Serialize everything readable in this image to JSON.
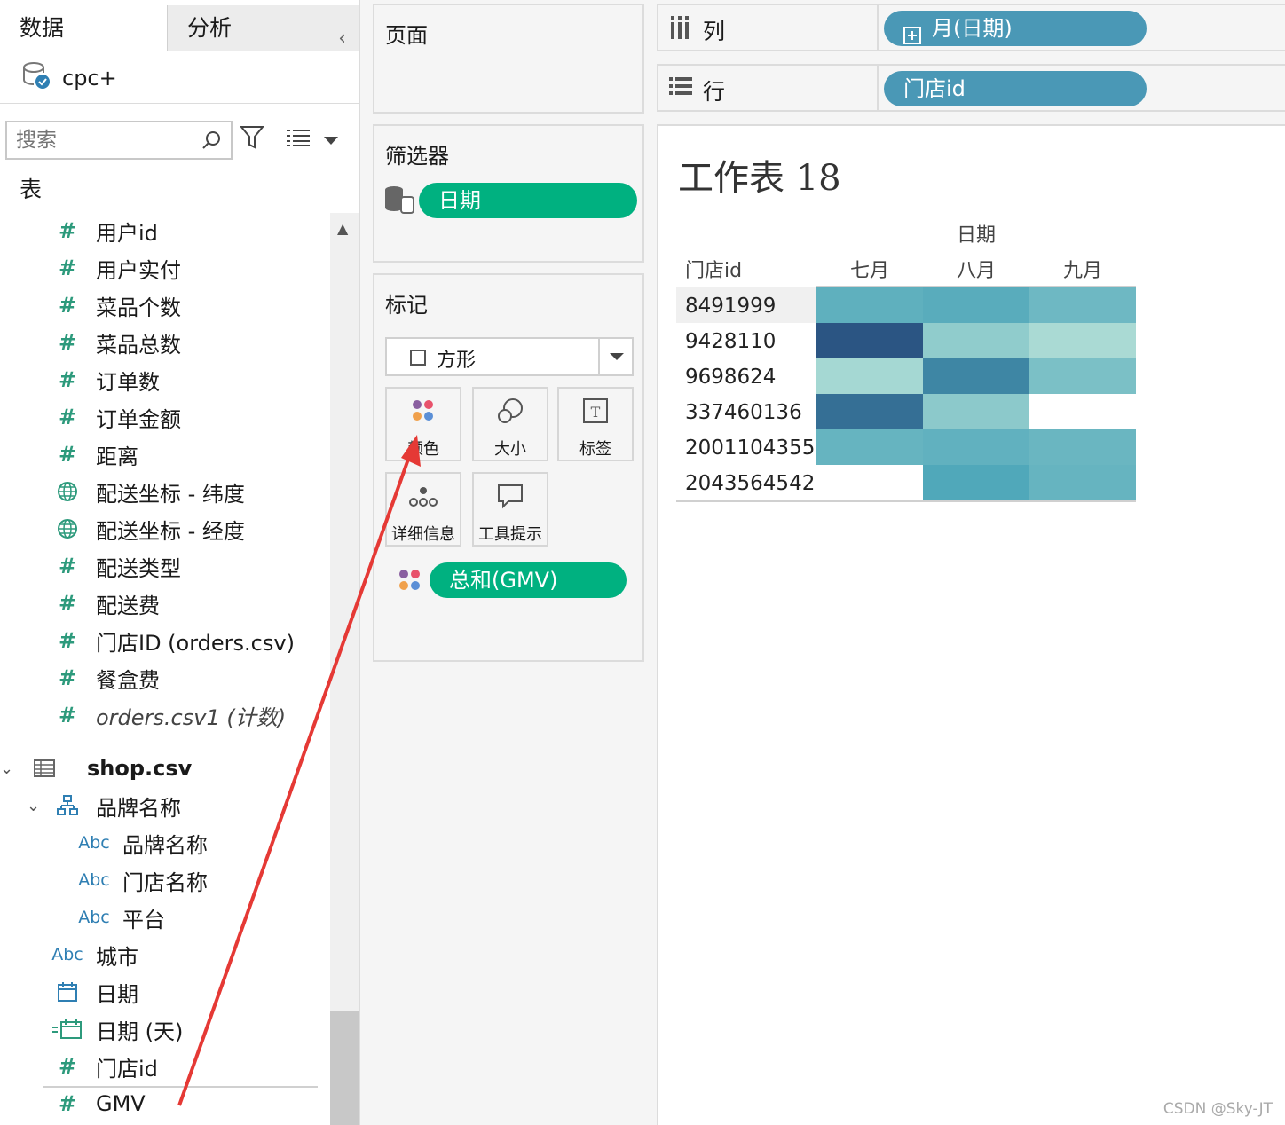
{
  "left_pane": {
    "tabs": {
      "data": "数据",
      "analysis": "分析"
    },
    "datasource": "cpc+",
    "search_placeholder": "搜索",
    "tables_title": "表",
    "orders_fields": [
      {
        "label": "用户id",
        "type": "measure"
      },
      {
        "label": "用户实付",
        "type": "measure"
      },
      {
        "label": "菜品个数",
        "type": "measure"
      },
      {
        "label": "菜品总数",
        "type": "measure"
      },
      {
        "label": "订单数",
        "type": "measure"
      },
      {
        "label": "订单金额",
        "type": "measure"
      },
      {
        "label": "距离",
        "type": "measure"
      },
      {
        "label": "配送坐标 - 纬度",
        "type": "geo"
      },
      {
        "label": "配送坐标 - 经度",
        "type": "geo"
      },
      {
        "label": "配送类型",
        "type": "measure"
      },
      {
        "label": "配送费",
        "type": "measure"
      },
      {
        "label": "门店ID (orders.csv)",
        "type": "measure"
      },
      {
        "label": "餐盒费",
        "type": "measure"
      },
      {
        "label": "orders.csv1 (计数)",
        "type": "measure-italic"
      }
    ],
    "shop_table": "shop.csv",
    "hierarchy": "品牌名称",
    "hierarchy_fields": [
      "品牌名称",
      "门店名称",
      "平台"
    ],
    "shop_fields": [
      {
        "label": "城市",
        "type": "string"
      },
      {
        "label": "日期",
        "type": "date"
      },
      {
        "label": "日期 (天)",
        "type": "date-custom"
      },
      {
        "label": "门店id",
        "type": "measure"
      },
      {
        "label": "GMV",
        "type": "measure"
      }
    ],
    "abc_label": "Abc"
  },
  "pages_shelf": {
    "title": "页面"
  },
  "filters_shelf": {
    "title": "筛选器",
    "pill": "日期"
  },
  "marks_card": {
    "title": "标记",
    "mark_type": "方形",
    "buttons": {
      "color": "颜色",
      "size": "大小",
      "label": "标签",
      "detail": "详细信息",
      "tooltip": "工具提示"
    },
    "color_pill": "总和(GMV)"
  },
  "columns_shelf": {
    "label": "列",
    "pill": "月(日期)"
  },
  "rows_shelf": {
    "label": "行",
    "pill": "门店id"
  },
  "view": {
    "sheet_title": "工作表 18",
    "watermark": "CSDN @Sky-JT"
  },
  "chart_data": {
    "type": "heatmap",
    "title": "工作表 18",
    "column_header": "日期",
    "row_header": "门店id",
    "x_categories": [
      "七月",
      "八月",
      "九月"
    ],
    "y_categories": [
      "8491999",
      "9428110",
      "9698624",
      "337460136",
      "2001104355",
      "2043564542"
    ],
    "measure": "总和(GMV)",
    "cells": [
      {
        "store": "8491999",
        "month": "七月",
        "level": 0.45
      },
      {
        "store": "8491999",
        "month": "八月",
        "level": 0.48
      },
      {
        "store": "8491999",
        "month": "九月",
        "level": 0.38
      },
      {
        "store": "9428110",
        "month": "七月",
        "level": 1.0
      },
      {
        "store": "9428110",
        "month": "八月",
        "level": 0.22
      },
      {
        "store": "9428110",
        "month": "九月",
        "level": 0.1
      },
      {
        "store": "9698624",
        "month": "七月",
        "level": 0.12
      },
      {
        "store": "9698624",
        "month": "八月",
        "level": 0.72
      },
      {
        "store": "9698624",
        "month": "九月",
        "level": 0.32
      },
      {
        "store": "337460136",
        "month": "七月",
        "level": 0.85
      },
      {
        "store": "337460136",
        "month": "八月",
        "level": 0.24
      },
      {
        "store": "2001104355",
        "month": "七月",
        "level": 0.42
      },
      {
        "store": "2001104355",
        "month": "八月",
        "level": 0.44
      },
      {
        "store": "2001104355",
        "month": "九月",
        "level": 0.4
      },
      {
        "store": "2043564542",
        "month": "八月",
        "level": 0.52
      },
      {
        "store": "2043564542",
        "month": "九月",
        "level": 0.42
      }
    ],
    "color_low": "#bfe6da",
    "color_high": "#2b5583"
  }
}
